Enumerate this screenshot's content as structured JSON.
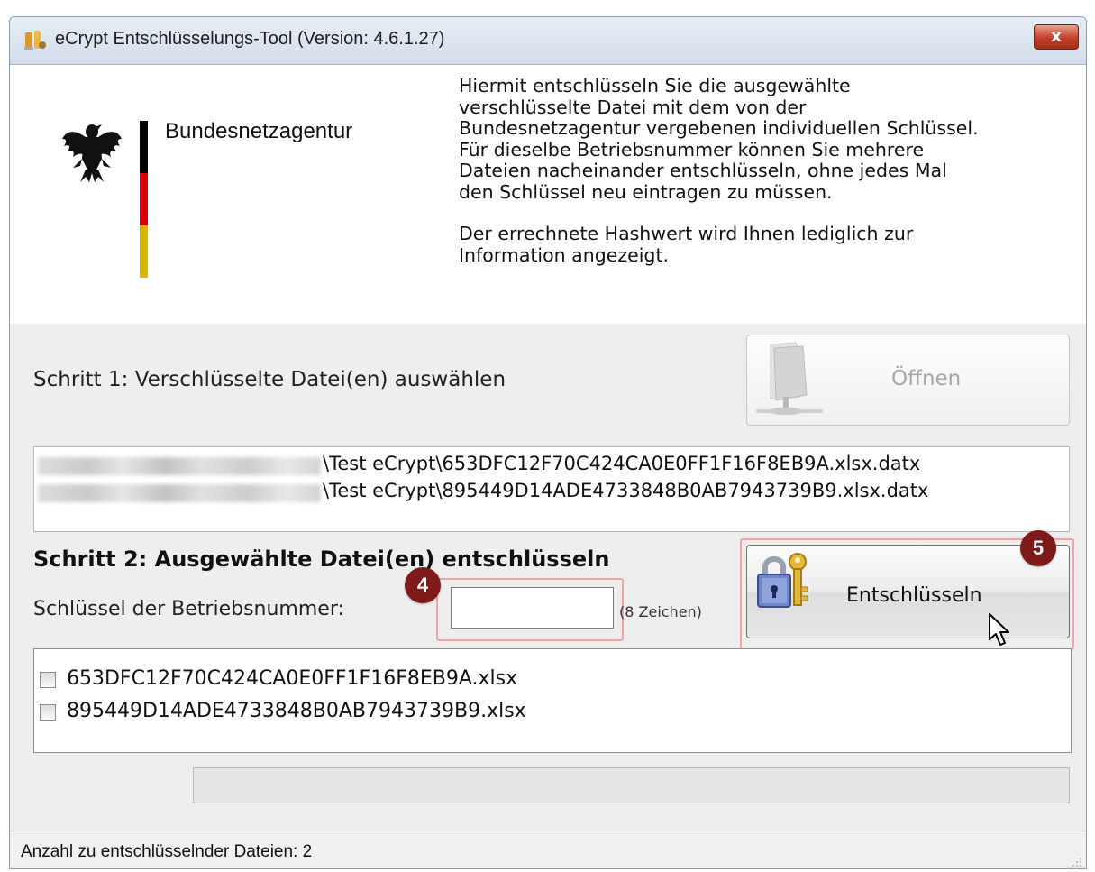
{
  "window": {
    "title": "eCrypt Entschlüsselungs-Tool (Version: 4.6.1.27)",
    "close_label": "x"
  },
  "header": {
    "agency_name": "Bundesnetzagentur",
    "info_paragraph_1": "Hiermit entschlüsseln Sie die ausgewählte\nverschlüsselte Datei mit dem von der\nBundesnetzagentur vergebenen individuellen Schlüssel.\nFür dieselbe Betriebsnummer können Sie mehrere\nDateien nacheinander entschlüsseln, ohne jedes Mal\nden Schlüssel neu eintragen zu müssen.",
    "info_paragraph_2": "Der errechnete Hashwert wird Ihnen lediglich zur\nInformation angezeigt.",
    "flag_colors": [
      "#000000",
      "#dd0000",
      "#ddb500"
    ]
  },
  "step1": {
    "label": "Schritt 1: Verschlüsselte Datei(en) auswählen",
    "open_button_label": "Öffnen",
    "open_button_enabled": false,
    "files": [
      "\\Test eCrypt\\653DFC12F70C424CA0E0FF1F16F8EB9A.xlsx.datx",
      "\\Test eCrypt\\895449D14ADE4733848B0AB7943739B9.xlsx.datx"
    ]
  },
  "step2": {
    "title": "Schritt 2: Ausgewählte Datei(en) entschlüsseln",
    "key_label": "Schlüssel der Betriebsnummer:",
    "key_value": "",
    "key_hint": "(8 Zeichen)",
    "decrypt_button_label": "Entschlüsseln",
    "checklist": [
      {
        "label": "653DFC12F70C424CA0E0FF1F16F8EB9A.xlsx",
        "checked": false
      },
      {
        "label": "895449D14ADE4733848B0AB7943739B9.xlsx",
        "checked": false
      }
    ]
  },
  "annotations": {
    "badge_4": "4",
    "badge_5": "5",
    "badge_color": "#7e1a1a",
    "highlight_color": "#f0a5a5"
  },
  "progress": {
    "value": 0
  },
  "status": {
    "text": "Anzahl zu entschlüsselnder Dateien: 2"
  }
}
